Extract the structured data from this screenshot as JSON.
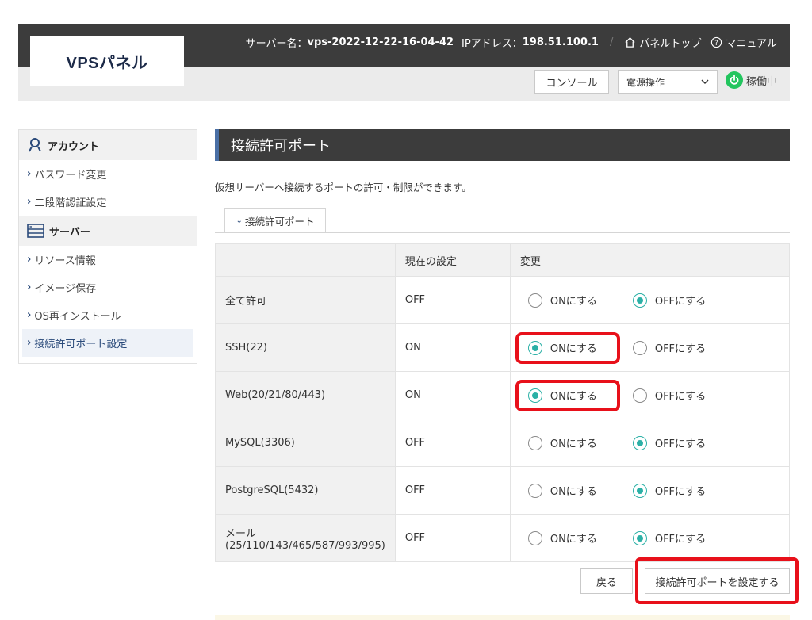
{
  "header": {
    "logo": "VPSパネル",
    "server_label": "サーバー名：",
    "server_name": "vps-2022-12-22-16-04-42",
    "ip_label": "IPアドレス：",
    "ip": "198.51.100.1",
    "panel_top": "パネルトップ",
    "manual": "マニュアル",
    "console": "コンソール",
    "power_select": "電源操作",
    "status": "稼働中"
  },
  "sidebar": {
    "account_heading": "アカウント",
    "account_items": [
      "パスワード変更",
      "二段階認証設定"
    ],
    "server_heading": "サーバー",
    "server_items": [
      "リソース情報",
      "イメージ保存",
      "OS再インストール",
      "接続許可ポート設定"
    ]
  },
  "main": {
    "title": "接続許可ポート",
    "description": "仮想サーバーへ接続するポートの許可・制限ができます。",
    "tab": "接続許可ポート",
    "col_current": "現在の設定",
    "col_change": "変更",
    "on_label": "ONにする",
    "off_label": "OFFにする",
    "rows": [
      {
        "name": "全て許可",
        "current": "OFF",
        "selected": "off"
      },
      {
        "name": "SSH(22)",
        "current": "ON",
        "selected": "on"
      },
      {
        "name": "Web(20/21/80/443)",
        "current": "ON",
        "selected": "on"
      },
      {
        "name": "MySQL(3306)",
        "current": "OFF",
        "selected": "off"
      },
      {
        "name": "PostgreSQL(5432)",
        "current": "OFF",
        "selected": "off"
      },
      {
        "name": "メール",
        "name2": "(25/110/143/465/587/993/995)",
        "current": "OFF",
        "selected": "off"
      }
    ],
    "back_button": "戻る",
    "submit_button": "接続許可ポートを設定する"
  },
  "colors": {
    "accent": "#2bb0a6",
    "highlight": "#e8101a",
    "header": "#3c3c3c"
  }
}
